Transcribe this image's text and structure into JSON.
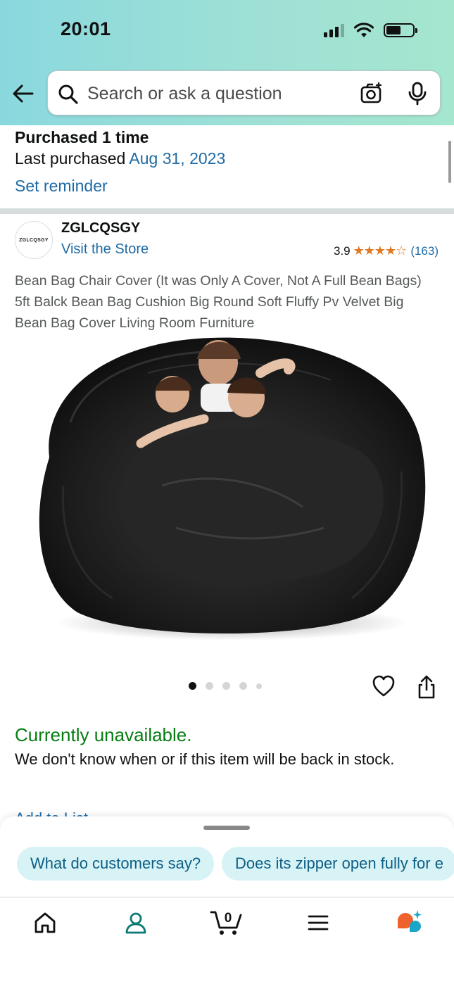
{
  "status_bar": {
    "time": "20:01"
  },
  "search": {
    "placeholder": "Search or ask a question"
  },
  "purchase": {
    "purchased_text": "Purchased 1 time",
    "last_purchased_label": "Last purchased",
    "last_purchased_date": "Aug 31, 2023",
    "set_reminder": "Set reminder"
  },
  "store": {
    "logo_text": "ZGLCQSGY",
    "name": "ZGLCQSGY",
    "visit_label": "Visit the Store",
    "rating": "3.9",
    "stars_filled": 4,
    "stars_total": 5,
    "review_count": "(163)"
  },
  "product": {
    "title": "Bean Bag Chair Cover (It was Only A Cover, Not A Full Bean Bags) 5ft Balck Bean Bag Cushion Big Round Soft Fluffy Pv Velvet Big Bean Bag Cover Living Room Furniture",
    "image_count": 5,
    "active_image": 1
  },
  "availability": {
    "status": "Currently unavailable.",
    "message": "We don't know when or if this item will be back in stock.",
    "add_to_list": "Add to List"
  },
  "suggestions": [
    "What do customers say?",
    "Does its zipper open fully for e"
  ],
  "bottom_nav": [
    {
      "name": "home-icon"
    },
    {
      "name": "account-icon"
    },
    {
      "name": "cart-icon",
      "badge": "0"
    },
    {
      "name": "menu-icon"
    },
    {
      "name": "rufus-icon"
    }
  ],
  "colors": {
    "header_gradient_start": "#8ad8de",
    "header_gradient_end": "#a5e6cf",
    "link": "#1d6aa5",
    "available_green": "#067d12",
    "star": "#de7921",
    "chip_bg": "#d7f3f6"
  }
}
